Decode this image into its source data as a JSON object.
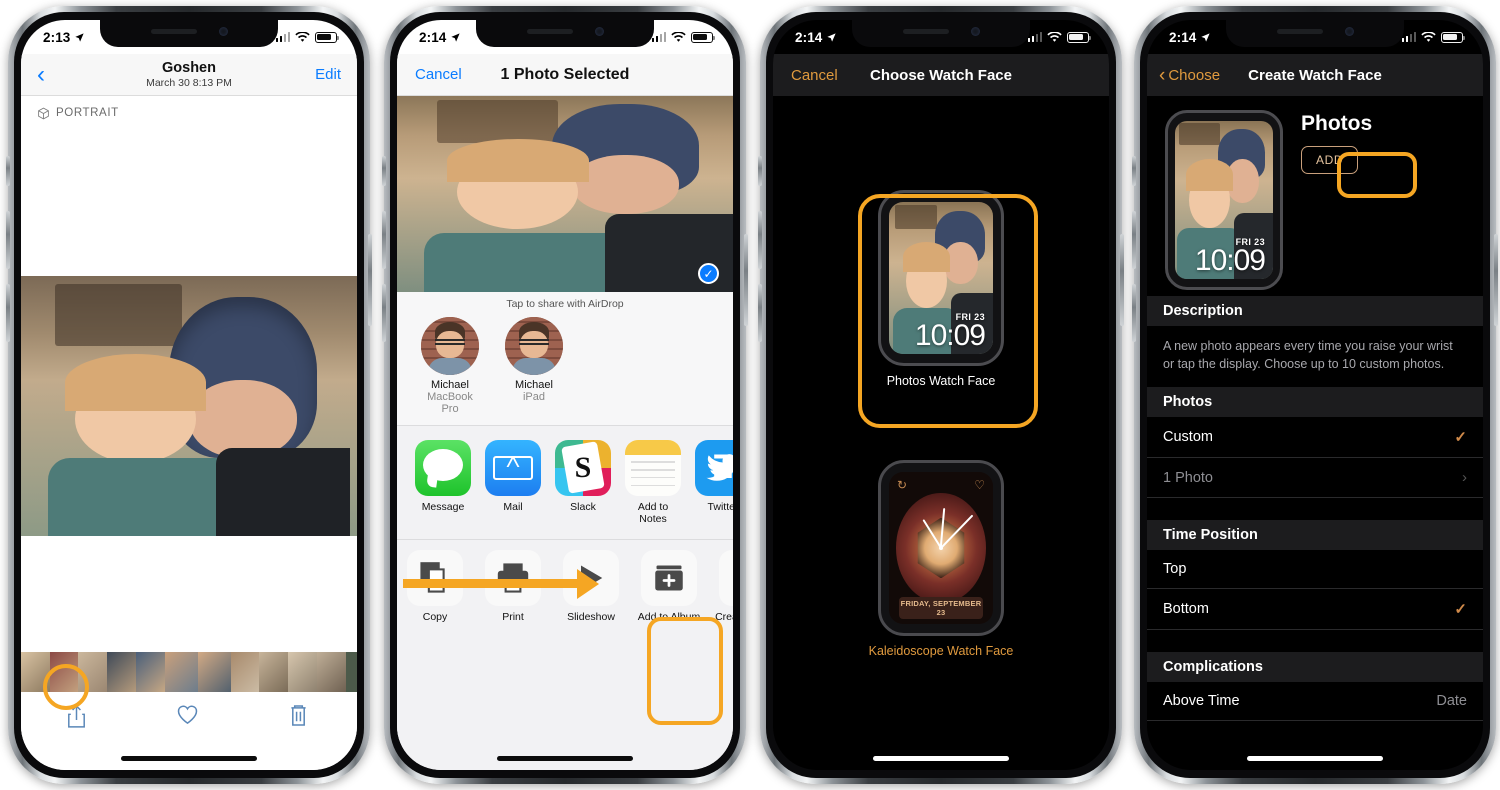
{
  "meta": {
    "accent_orange": "#f5a623",
    "ios_blue": "#0a7cff",
    "watch_orange": "#e09a3e"
  },
  "phone1": {
    "status": {
      "time": "2:13",
      "location_icon": "location-arrow-icon",
      "cellular": "signal-bars-icon",
      "wifi": "wifi-icon",
      "battery": "battery-icon"
    },
    "nav": {
      "back_icon": "chevron-left-icon",
      "title": "Goshen",
      "subtitle": "March 30  8:13 PM",
      "edit": "Edit"
    },
    "portrait_badge": {
      "icon": "cube-icon",
      "label": "PORTRAIT"
    },
    "toolbar": {
      "share_icon": "share-icon",
      "favorite_icon": "heart-icon",
      "delete_icon": "trash-icon"
    },
    "highlight": "share-button"
  },
  "phone2": {
    "status": {
      "time": "2:14"
    },
    "nav": {
      "cancel": "Cancel",
      "title": "1 Photo Selected"
    },
    "selected_check": "checkmark-icon",
    "airdrop": {
      "caption": "Tap to share with AirDrop",
      "targets": [
        {
          "name": "Michael",
          "device": "MacBook Pro"
        },
        {
          "name": "Michael",
          "device": "iPad"
        }
      ]
    },
    "apps": [
      {
        "label": "Message",
        "icon": "messages-icon"
      },
      {
        "label": "Mail",
        "icon": "mail-icon"
      },
      {
        "label": "Slack",
        "icon": "slack-icon"
      },
      {
        "label": "Add to Notes",
        "icon": "notes-icon"
      },
      {
        "label": "Twitter",
        "icon": "twitter-icon"
      }
    ],
    "actions": [
      {
        "label": "Copy",
        "icon": "copy-icon"
      },
      {
        "label": "Print",
        "icon": "printer-icon"
      },
      {
        "label": "Slideshow",
        "icon": "play-icon"
      },
      {
        "label": "Add to Album",
        "icon": "add-album-icon"
      },
      {
        "label": "Create Watch Face",
        "icon": "watch-icon"
      }
    ],
    "highlight": "create-watch-face-action"
  },
  "phone3": {
    "status": {
      "time": "2:14"
    },
    "nav": {
      "cancel": "Cancel",
      "title": "Choose Watch Face"
    },
    "faces": [
      {
        "label": "Photos Watch Face",
        "time": "10:09",
        "date": "FRI 23",
        "selected": true
      },
      {
        "label": "Kaleidoscope Watch Face",
        "date_banner": "FRIDAY, SEPTEMBER 23",
        "selected": false
      }
    ],
    "highlight": "photos-watch-face-option"
  },
  "phone4": {
    "status": {
      "time": "2:14"
    },
    "nav": {
      "back_label": "Choose",
      "title": "Create Watch Face"
    },
    "preview": {
      "title": "Photos",
      "add_label": "ADD",
      "watch_time": "10:09",
      "watch_date": "FRI 23"
    },
    "sections": [
      {
        "header": "Description",
        "type": "text",
        "text": "A new photo appears every time you raise your wrist or tap the display. Choose up to 10 custom photos."
      },
      {
        "header": "Photos",
        "type": "rows",
        "rows": [
          {
            "label": "Custom",
            "accessory": "check",
            "dim": false
          },
          {
            "label": "1 Photo",
            "accessory": "chevron",
            "dim": true
          }
        ]
      },
      {
        "header": "Time Position",
        "type": "rows",
        "rows": [
          {
            "label": "Top",
            "accessory": "none",
            "dim": false
          },
          {
            "label": "Bottom",
            "accessory": "check",
            "dim": false
          }
        ]
      },
      {
        "header": "Complications",
        "type": "rows",
        "rows": [
          {
            "label": "Above Time",
            "accessory": "value",
            "value": "Date",
            "dim": false
          }
        ]
      }
    ],
    "highlight": "add-photo-button"
  }
}
